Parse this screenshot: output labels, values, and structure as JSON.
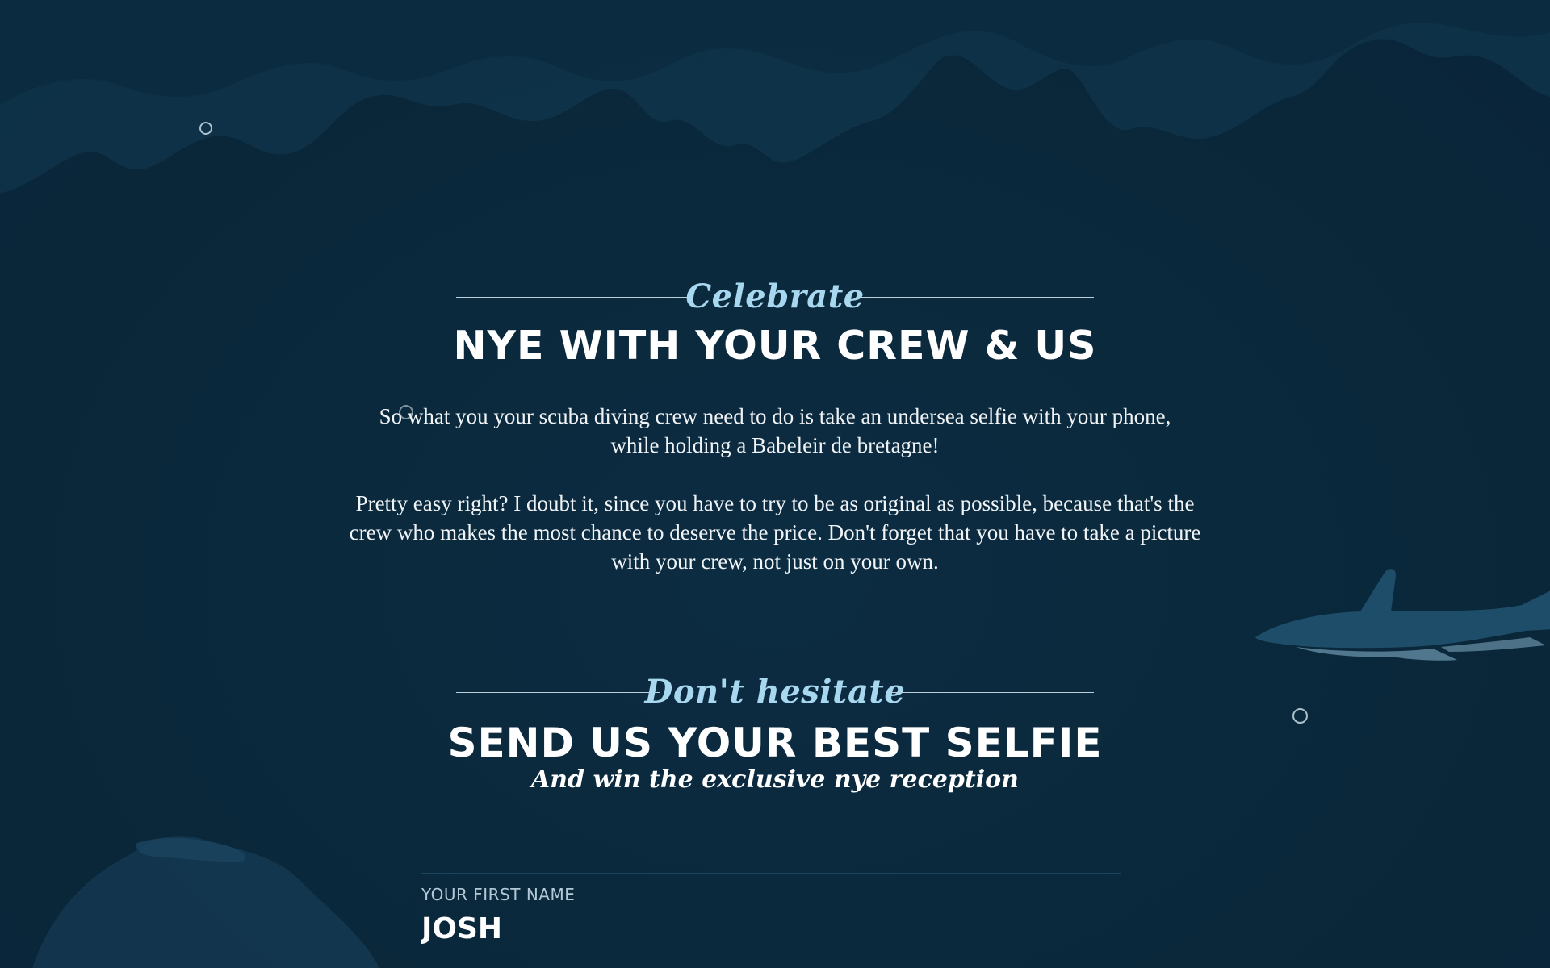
{
  "section_celebrate": {
    "eyebrow": "Celebrate",
    "heading": "NYE WITH YOUR CREW & US",
    "paragraph_1": "So what you your scuba diving crew need to do is take an undersea selfie with your phone, while holding a Babeleir de bretagne!",
    "paragraph_2": "Pretty easy right? I doubt it, since you have to try to be as original as possible, because that's the crew who makes the most chance to deserve the price. Don't forget that you have to take a picture with your crew, not just on your own."
  },
  "section_selfie": {
    "eyebrow": "Don't hesitate",
    "heading": "SEND US YOUR BEST SELFIE",
    "tagline": "And win the exclusive nye reception"
  },
  "form": {
    "first_name_label": "YOUR FIRST NAME",
    "first_name_value": "JOSH"
  },
  "colors": {
    "background": "#0b2a3e",
    "accent": "#a8d8f0",
    "text": "#ffffff"
  }
}
